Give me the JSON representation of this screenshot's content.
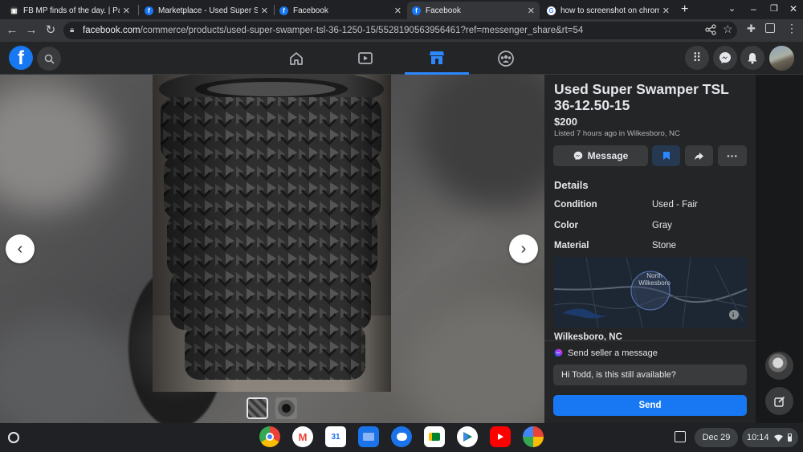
{
  "browser": {
    "tabs": [
      {
        "title": "FB MP finds of the day. | Page",
        "favicon": "fb-mp-icon",
        "active": false
      },
      {
        "title": "Marketplace - Used Super Swa",
        "favicon": "facebook-icon",
        "active": false
      },
      {
        "title": "Facebook",
        "favicon": "facebook-icon",
        "active": false
      },
      {
        "title": "Facebook",
        "favicon": "facebook-icon",
        "active": true
      },
      {
        "title": "how to screenshot on chrome",
        "favicon": "google-icon",
        "active": false
      }
    ],
    "url_domain": "facebook.com",
    "url_path": "/commerce/products/used-super-swamper-tsl-36-1250-15/5528190563956461?ref=messenger_share&rt=54"
  },
  "listing": {
    "title": "Used Super Swamper TSL 36-12.50-15",
    "price": "$200",
    "listed": "Listed 7 hours ago in Wilkesboro, NC",
    "message_label": "Message",
    "details_heading": "Details",
    "details": [
      {
        "label": "Condition",
        "value": "Used - Fair"
      },
      {
        "label": "Color",
        "value": "Gray"
      },
      {
        "label": "Material",
        "value": "Stone"
      }
    ],
    "map_label": "North Wilkesboro",
    "location": "Wilkesboro, NC",
    "send_seller_heading": "Send seller a message",
    "message_text": "Hi Todd, is this still available?",
    "send_label": "Send"
  },
  "shelf": {
    "date": "Dec 29",
    "time": "10:14",
    "apps": [
      "chrome-icon",
      "gmail-icon",
      "calendar-icon",
      "files-icon",
      "messages-icon",
      "meet-icon",
      "play-store-icon",
      "youtube-icon",
      "photos-icon"
    ]
  },
  "colors": {
    "accent": "#2d88ff",
    "send_button": "#1877f2",
    "panel_bg": "#242526"
  }
}
